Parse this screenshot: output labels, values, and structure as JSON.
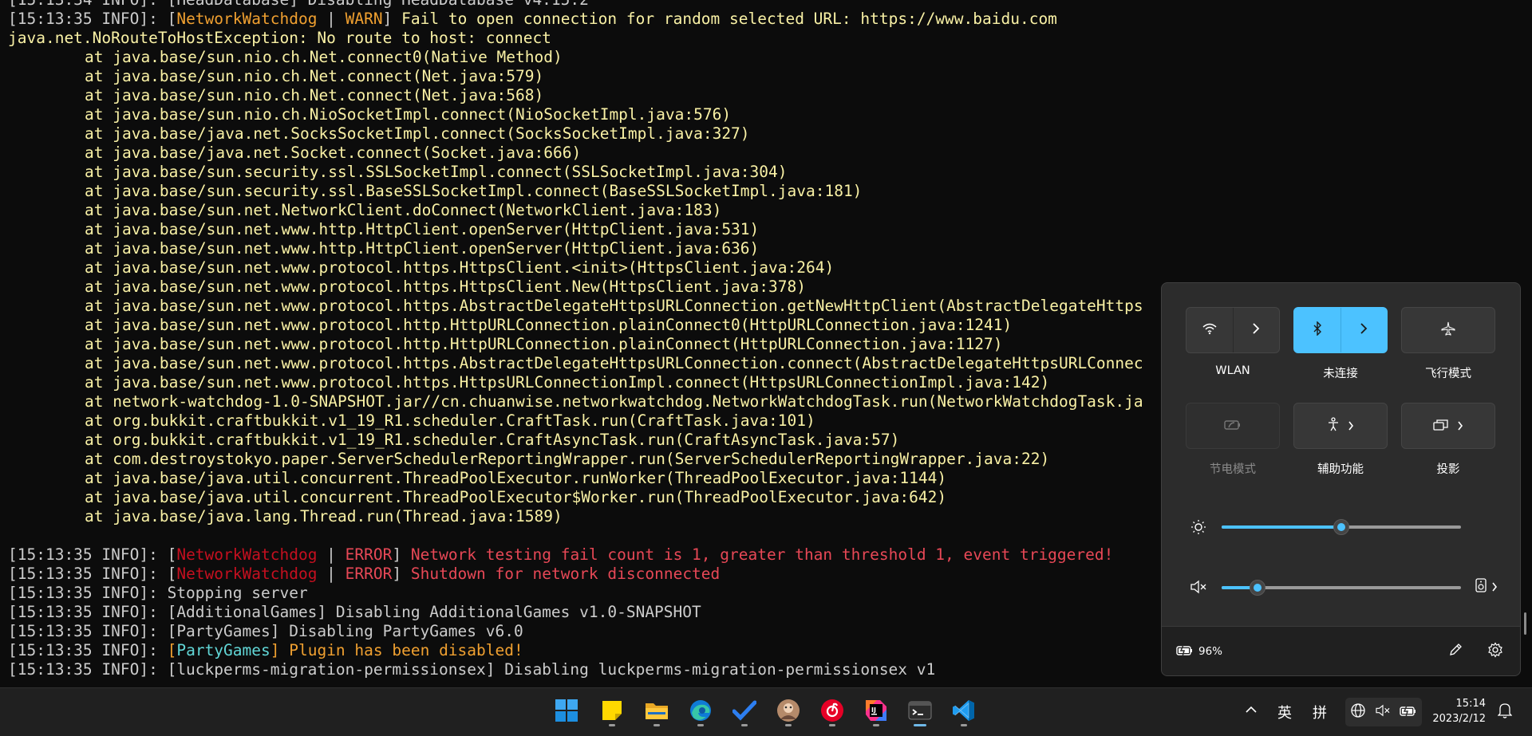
{
  "console": {
    "lines": [
      {
        "indent": false,
        "segments": [
          {
            "text": "[15:13:34 INFO]: [HeadDatabase] Disabling HeadDatabase v4.15.2",
            "color": "white"
          }
        ]
      },
      {
        "indent": false,
        "segments": [
          {
            "text": "[15:13:35 INFO]: [",
            "color": "white"
          },
          {
            "text": "NetworkWatchdog",
            "color": "orange"
          },
          {
            "text": " | ",
            "color": "white"
          },
          {
            "text": "WARN",
            "color": "orange"
          },
          {
            "text": "] ",
            "color": "white"
          },
          {
            "text": "Fail to open connection for random selected URL: https://www.baidu.com",
            "color": "yellow"
          }
        ]
      },
      {
        "indent": false,
        "segments": [
          {
            "text": "java.net.NoRouteToHostException: No route to host: connect",
            "color": "yellow"
          }
        ]
      },
      {
        "indent": true,
        "segments": [
          {
            "text": "at java.base/sun.nio.ch.Net.connect0(Native Method)",
            "color": "yellow"
          }
        ]
      },
      {
        "indent": true,
        "segments": [
          {
            "text": "at java.base/sun.nio.ch.Net.connect(Net.java:579)",
            "color": "yellow"
          }
        ]
      },
      {
        "indent": true,
        "segments": [
          {
            "text": "at java.base/sun.nio.ch.Net.connect(Net.java:568)",
            "color": "yellow"
          }
        ]
      },
      {
        "indent": true,
        "segments": [
          {
            "text": "at java.base/sun.nio.ch.NioSocketImpl.connect(NioSocketImpl.java:576)",
            "color": "yellow"
          }
        ]
      },
      {
        "indent": true,
        "segments": [
          {
            "text": "at java.base/java.net.SocksSocketImpl.connect(SocksSocketImpl.java:327)",
            "color": "yellow"
          }
        ]
      },
      {
        "indent": true,
        "segments": [
          {
            "text": "at java.base/java.net.Socket.connect(Socket.java:666)",
            "color": "yellow"
          }
        ]
      },
      {
        "indent": true,
        "segments": [
          {
            "text": "at java.base/sun.security.ssl.SSLSocketImpl.connect(SSLSocketImpl.java:304)",
            "color": "yellow"
          }
        ]
      },
      {
        "indent": true,
        "segments": [
          {
            "text": "at java.base/sun.security.ssl.BaseSSLSocketImpl.connect(BaseSSLSocketImpl.java:181)",
            "color": "yellow"
          }
        ]
      },
      {
        "indent": true,
        "segments": [
          {
            "text": "at java.base/sun.net.NetworkClient.doConnect(NetworkClient.java:183)",
            "color": "yellow"
          }
        ]
      },
      {
        "indent": true,
        "segments": [
          {
            "text": "at java.base/sun.net.www.http.HttpClient.openServer(HttpClient.java:531)",
            "color": "yellow"
          }
        ]
      },
      {
        "indent": true,
        "segments": [
          {
            "text": "at java.base/sun.net.www.http.HttpClient.openServer(HttpClient.java:636)",
            "color": "yellow"
          }
        ]
      },
      {
        "indent": true,
        "segments": [
          {
            "text": "at java.base/sun.net.www.protocol.https.HttpsClient.<init>(HttpsClient.java:264)",
            "color": "yellow"
          }
        ]
      },
      {
        "indent": true,
        "segments": [
          {
            "text": "at java.base/sun.net.www.protocol.https.HttpsClient.New(HttpsClient.java:378)",
            "color": "yellow"
          }
        ]
      },
      {
        "indent": true,
        "segments": [
          {
            "text": "at java.base/sun.net.www.protocol.https.AbstractDelegateHttpsURLConnection.getNewHttpClient(AbstractDelegateHttps",
            "color": "yellow"
          }
        ]
      },
      {
        "indent": true,
        "segments": [
          {
            "text": "at java.base/sun.net.www.protocol.http.HttpURLConnection.plainConnect0(HttpURLConnection.java:1241)",
            "color": "yellow"
          }
        ]
      },
      {
        "indent": true,
        "segments": [
          {
            "text": "at java.base/sun.net.www.protocol.http.HttpURLConnection.plainConnect(HttpURLConnection.java:1127)",
            "color": "yellow"
          }
        ]
      },
      {
        "indent": true,
        "segments": [
          {
            "text": "at java.base/sun.net.www.protocol.https.AbstractDelegateHttpsURLConnection.connect(AbstractDelegateHttpsURLConnec",
            "color": "yellow"
          }
        ]
      },
      {
        "indent": true,
        "segments": [
          {
            "text": "at java.base/sun.net.www.protocol.https.HttpsURLConnectionImpl.connect(HttpsURLConnectionImpl.java:142)",
            "color": "yellow"
          }
        ]
      },
      {
        "indent": true,
        "segments": [
          {
            "text": "at network-watchdog-1.0-SNAPSHOT.jar//cn.chuanwise.networkwatchdog.NetworkWatchdogTask.run(NetworkWatchdogTask.ja",
            "color": "yellow"
          }
        ]
      },
      {
        "indent": true,
        "segments": [
          {
            "text": "at org.bukkit.craftbukkit.v1_19_R1.scheduler.CraftTask.run(CraftTask.java:101)",
            "color": "yellow"
          }
        ]
      },
      {
        "indent": true,
        "segments": [
          {
            "text": "at org.bukkit.craftbukkit.v1_19_R1.scheduler.CraftAsyncTask.run(CraftAsyncTask.java:57)",
            "color": "yellow"
          }
        ]
      },
      {
        "indent": true,
        "segments": [
          {
            "text": "at com.destroystokyo.paper.ServerSchedulerReportingWrapper.run(ServerSchedulerReportingWrapper.java:22)",
            "color": "yellow"
          }
        ]
      },
      {
        "indent": true,
        "segments": [
          {
            "text": "at java.base/java.util.concurrent.ThreadPoolExecutor.runWorker(ThreadPoolExecutor.java:1144)",
            "color": "yellow"
          }
        ]
      },
      {
        "indent": true,
        "segments": [
          {
            "text": "at java.base/java.util.concurrent.ThreadPoolExecutor$Worker.run(ThreadPoolExecutor.java:642)",
            "color": "yellow"
          }
        ]
      },
      {
        "indent": true,
        "segments": [
          {
            "text": "at java.base/java.lang.Thread.run(Thread.java:1589)",
            "color": "yellow"
          }
        ]
      },
      {
        "indent": false,
        "segments": [
          {
            "text": "",
            "color": "white"
          }
        ]
      },
      {
        "indent": false,
        "segments": [
          {
            "text": "[15:13:35 INFO]: [",
            "color": "white"
          },
          {
            "text": "NetworkWatchdog",
            "color": "dred"
          },
          {
            "text": " | ",
            "color": "white"
          },
          {
            "text": "ERROR",
            "color": "red"
          },
          {
            "text": "] ",
            "color": "white"
          },
          {
            "text": "Network testing fail count is 1, greater than threshold 1, event triggered!",
            "color": "red"
          }
        ]
      },
      {
        "indent": false,
        "segments": [
          {
            "text": "[15:13:35 INFO]: [",
            "color": "white"
          },
          {
            "text": "NetworkWatchdog",
            "color": "dred"
          },
          {
            "text": " | ",
            "color": "white"
          },
          {
            "text": "ERROR",
            "color": "red"
          },
          {
            "text": "] ",
            "color": "white"
          },
          {
            "text": "Shutdown for network disconnected",
            "color": "red"
          }
        ]
      },
      {
        "indent": false,
        "segments": [
          {
            "text": "[15:13:35 INFO]: Stopping server",
            "color": "white"
          }
        ]
      },
      {
        "indent": false,
        "segments": [
          {
            "text": "[15:13:35 INFO]: [AdditionalGames] Disabling AdditionalGames v1.0-SNAPSHOT",
            "color": "white"
          }
        ]
      },
      {
        "indent": false,
        "segments": [
          {
            "text": "[15:13:35 INFO]: [PartyGames] Disabling PartyGames v6.0",
            "color": "white"
          }
        ]
      },
      {
        "indent": false,
        "segments": [
          {
            "text": "[15:13:35 INFO]: ",
            "color": "white"
          },
          {
            "text": "[",
            "color": "orange"
          },
          {
            "text": "PartyGames",
            "color": "cyan"
          },
          {
            "text": "] Plugin has been disabled!",
            "color": "orange"
          }
        ]
      },
      {
        "indent": false,
        "segments": [
          {
            "text": "[15:13:35 INFO]: [luckperms-migration-permissionsex] Disabling luckperms-migration-permissionsex v1",
            "color": "white"
          }
        ]
      }
    ]
  },
  "quick_settings": {
    "tiles": [
      {
        "label": "WLAN",
        "icon": "wifi-icon",
        "state": "off",
        "expandable": true
      },
      {
        "label": "未连接",
        "icon": "bluetooth-icon",
        "state": "on",
        "expandable": true
      },
      {
        "label": "飞行模式",
        "icon": "airplane-icon",
        "state": "off",
        "expandable": false
      },
      {
        "label": "节电模式",
        "icon": "battery-saver-icon",
        "state": "disabled",
        "expandable": false
      },
      {
        "label": "辅助功能",
        "icon": "accessibility-icon",
        "state": "off",
        "expandable": true
      },
      {
        "label": "投影",
        "icon": "project-icon",
        "state": "off",
        "expandable": true
      }
    ],
    "brightness": {
      "icon": "brightness-icon",
      "level": 0.5
    },
    "volume": {
      "icon": "volume-mute-icon",
      "level": 0.15,
      "output_icon": "speaker-device-icon"
    },
    "battery_text": "96%",
    "battery_icon": "battery-charging-icon",
    "edit_icon": "pencil-icon",
    "settings_icon": "gear-icon",
    "accent_color": "#4cc2ff"
  },
  "taskbar": {
    "apps": [
      {
        "name": "start",
        "icon": "windows-logo-icon"
      },
      {
        "name": "sticky-notes",
        "icon": "sticky-notes-icon",
        "running": true
      },
      {
        "name": "file-explorer",
        "icon": "folder-icon",
        "running": true
      },
      {
        "name": "edge",
        "icon": "edge-icon",
        "running": true
      },
      {
        "name": "todo",
        "icon": "todo-check-icon",
        "running": true
      },
      {
        "name": "avatar-app",
        "icon": "avatar-icon",
        "running": true
      },
      {
        "name": "netease-music",
        "icon": "netease-music-icon",
        "running": true
      },
      {
        "name": "intellij",
        "icon": "intellij-icon",
        "running": true
      },
      {
        "name": "terminal",
        "icon": "terminal-icon",
        "running": true
      },
      {
        "name": "vscode",
        "icon": "vscode-icon",
        "running": true
      }
    ],
    "tray": {
      "chevron": "^",
      "ime_lang": "英",
      "ime_mode": "拼"
    },
    "time": "15:14",
    "date": "2023/2/12"
  }
}
